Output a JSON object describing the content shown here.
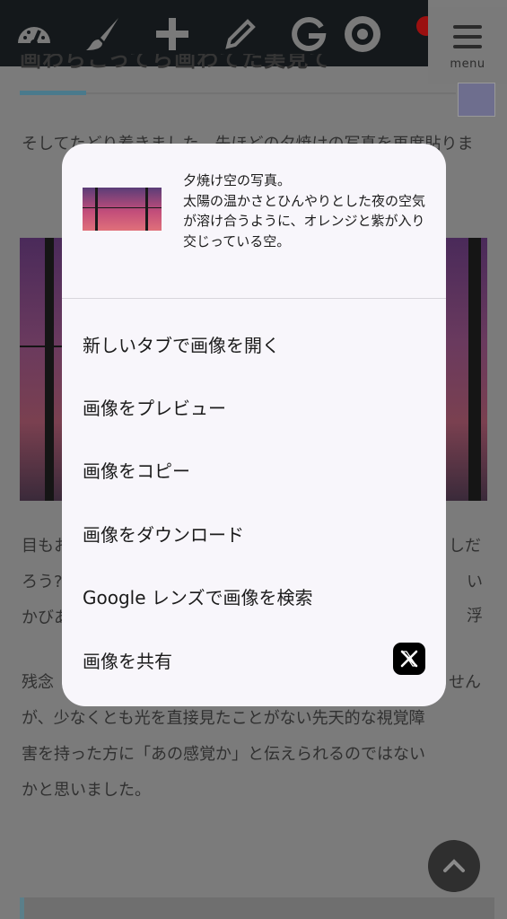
{
  "toolbar": {
    "icons": [
      "dashboard-icon",
      "brush-icon",
      "plus-icon",
      "pencil-icon",
      "google-icon",
      "gear-icon"
    ],
    "menu_label": "menu"
  },
  "article": {
    "heading_fragment": "画わらこってら画わてた美見て",
    "paragraph_top": "そしてたどり着きました。先ほどの夕焼けの写真を再度貼りま",
    "paragraph_mid_fragments": [
      "目もお",
      "しだ",
      "ろう?",
      "い浮",
      "かびあ"
    ],
    "paragraph_bottom_lines": [
      "残念",
      "せん",
      "が、少なくとも光を直接見たことがない先天的な視覚障",
      "害を持った方に「あの感覚か」と伝えられるのではない",
      "かと思いました。"
    ]
  },
  "context_menu": {
    "alt_text": "夕焼け空の写真。\n太陽の温かさとひんやりとした夜の空気が溶け合うように、オレンジと紫が入り交じっている空。",
    "items": [
      {
        "label": "新しいタブで画像を開く"
      },
      {
        "label": "画像をプレビュー"
      },
      {
        "label": "画像をコピー"
      },
      {
        "label": "画像をダウンロード"
      },
      {
        "label": "Google レンズで画像を検索"
      },
      {
        "label": "画像を共有",
        "trailing_icon": "x-logo-icon"
      }
    ]
  },
  "colors": {
    "scrim": "#7b7b7b",
    "menu_bg": "#f8f6fb",
    "toolbar_bg": "#14181b",
    "accent": "#4a7a8c"
  }
}
